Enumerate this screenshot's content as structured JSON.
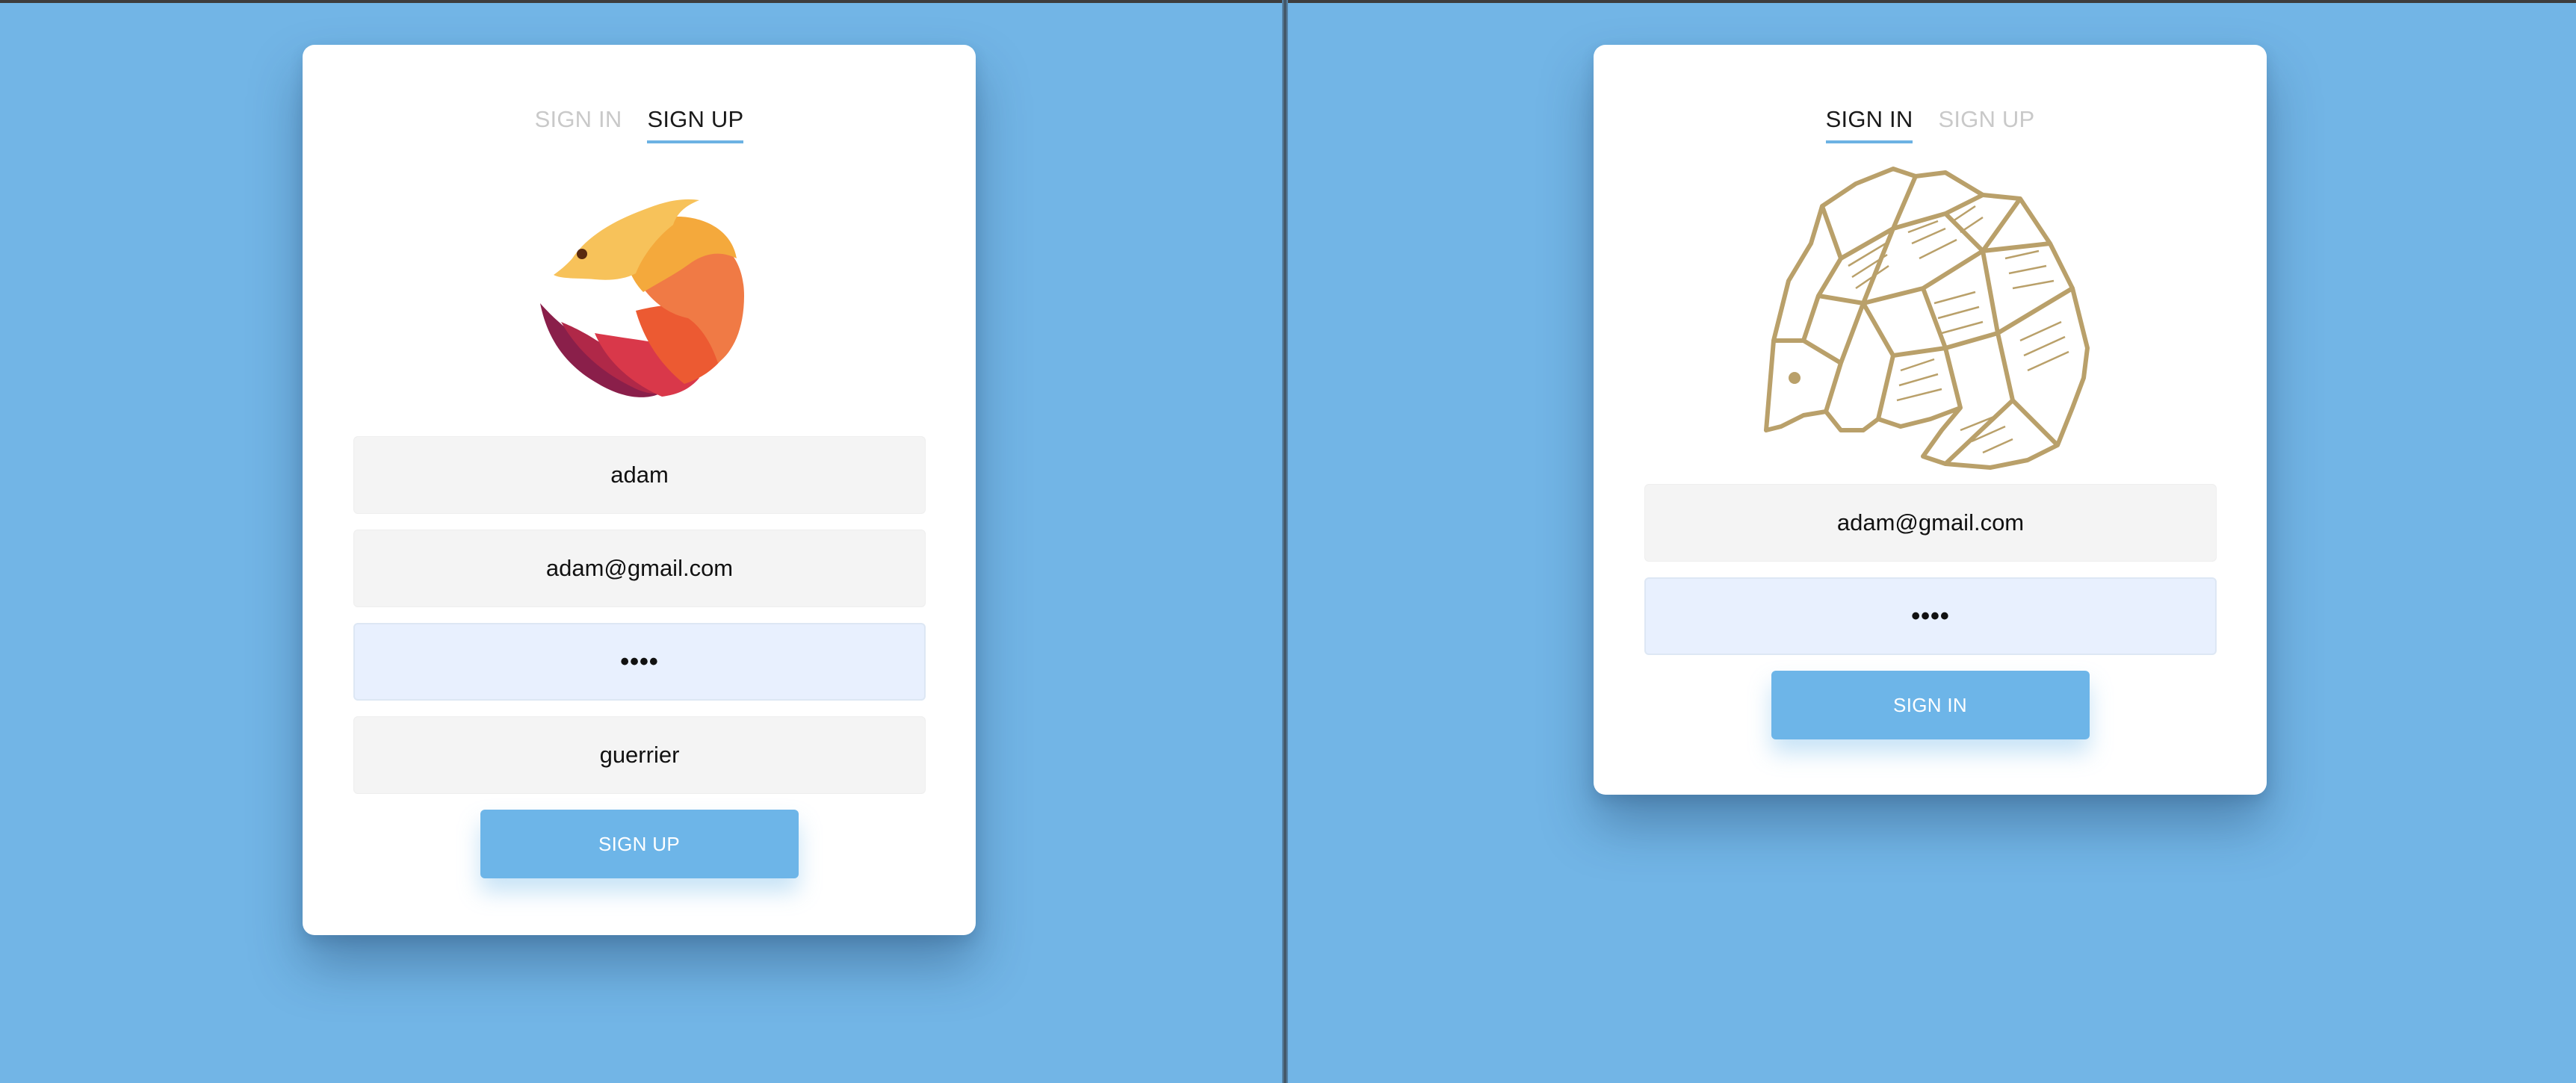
{
  "left_pane": {
    "tabs": [
      {
        "label": "SIGN IN",
        "active": false
      },
      {
        "label": "SIGN UP",
        "active": true
      }
    ],
    "logo_icon": "pangolin-color-logo",
    "fields": {
      "username": "adam",
      "email": "adam@gmail.com",
      "password_mask": "••••",
      "clan": "guerrier"
    },
    "submit_label": "SIGN UP"
  },
  "right_pane": {
    "tabs": [
      {
        "label": "SIGN IN",
        "active": true
      },
      {
        "label": "SIGN UP",
        "active": false
      }
    ],
    "logo_icon": "pangolin-outline-logo",
    "fields": {
      "email": "adam@gmail.com",
      "password_mask": "••••"
    },
    "submit_label": "SIGN IN"
  },
  "colors": {
    "background": "#72b5e6",
    "accent": "#6db5e8",
    "tab_inactive": "#c9c9c9",
    "logo_gold": "#b9a06a"
  }
}
